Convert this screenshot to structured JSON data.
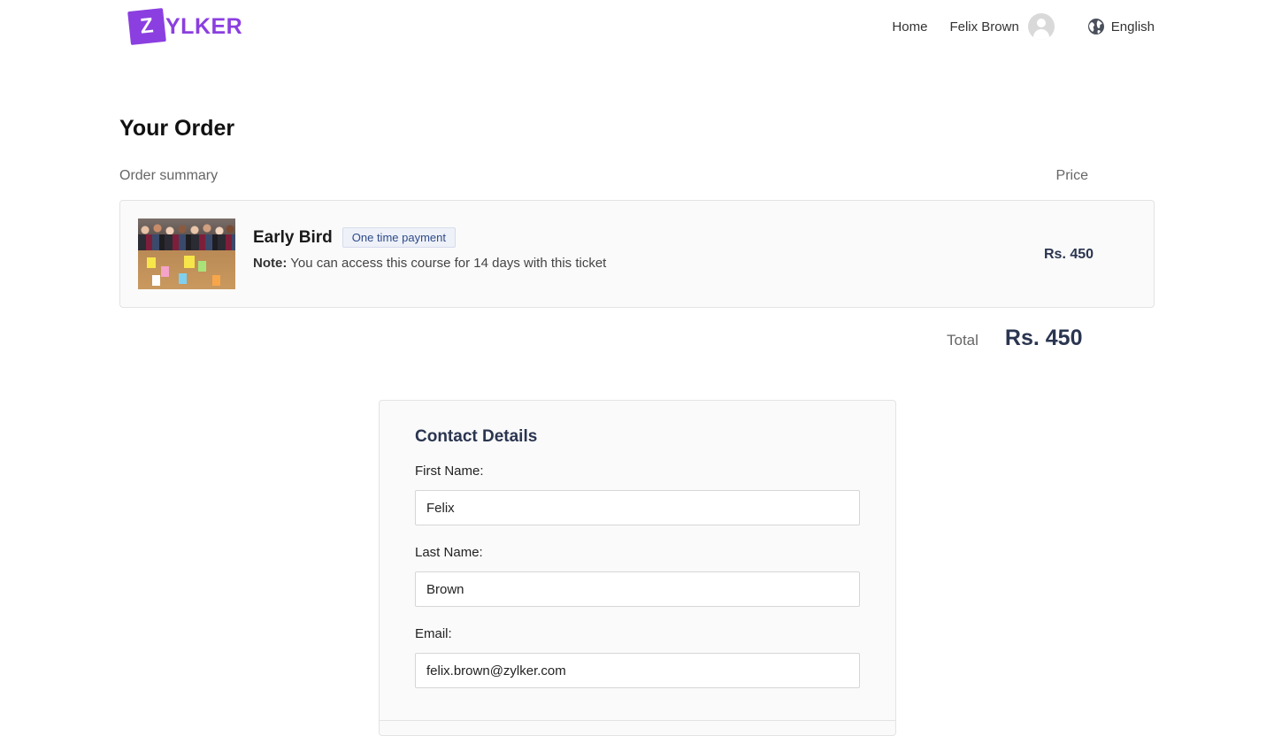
{
  "brand": {
    "logo_initial": "Z",
    "logo_rest": "YLKER",
    "primary_color": "#8b3fe0",
    "text_color": "#8b3fe0"
  },
  "nav": {
    "home_label": "Home",
    "user_name": "Felix Brown",
    "language_label": "English"
  },
  "order": {
    "title": "Your Order",
    "summary_label": "Order summary",
    "price_label": "Price",
    "item": {
      "image_icon": "course-thumbnail-image",
      "name": "Early Bird",
      "badge": "One time payment",
      "note_label": "Note:",
      "note_text": " You can access this course for 14 days with this ticket",
      "price": "Rs. 450"
    },
    "total_label": "Total",
    "total_value": "Rs. 450"
  },
  "contact": {
    "title": "Contact Details",
    "first_name_label": "First Name:",
    "first_name_value": "Felix",
    "last_name_label": "Last Name:",
    "last_name_value": "Brown",
    "email_label": "Email:",
    "email_value": "felix.brown@zylker.com"
  }
}
